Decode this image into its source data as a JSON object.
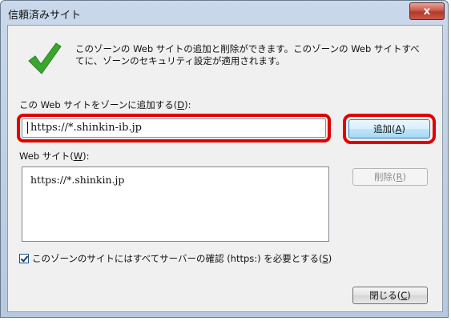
{
  "window": {
    "title": "信頼済みサイト",
    "close_glyph": "x"
  },
  "description": "このゾーンの Web サイトの追加と削除ができます。このゾーンの Web サイトすべてに、ゾーンのセキュリティ設定が適用されます。",
  "add_section": {
    "label_prefix": "この Web サイトをゾーンに追加する(",
    "label_key": "D",
    "label_suffix": "):",
    "input_value": "https://*.shinkin-ib.jp",
    "add_button_prefix": "追加(",
    "add_button_key": "A",
    "add_button_suffix": ")"
  },
  "sites_section": {
    "label_prefix": "Web サイト(",
    "label_key": "W",
    "label_suffix": "):",
    "items": [
      "https://*.shinkin.jp"
    ],
    "remove_button_prefix": "削除(",
    "remove_button_key": "R",
    "remove_button_suffix": ")"
  },
  "https_option": {
    "checked": true,
    "label_prefix": "このゾーンのサイトにはすべてサーバーの確認 (https:) を必要とする(",
    "label_key": "S",
    "label_suffix": ")"
  },
  "close_button": {
    "prefix": "閉じる(",
    "key": "C",
    "suffix": ")"
  },
  "colors": {
    "highlight": "#e00000",
    "checkmark": "#3aa62e"
  }
}
